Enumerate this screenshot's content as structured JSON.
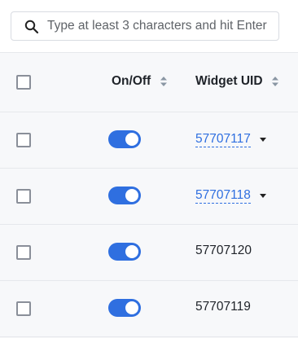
{
  "search": {
    "placeholder": "Type at least 3 characters and hit Enter",
    "value": ""
  },
  "table": {
    "columns": [
      {
        "label": "On/Off",
        "sortable": true
      },
      {
        "label": "Widget UID",
        "sortable": true
      }
    ],
    "rows": [
      {
        "uid": "57707117",
        "enabled": true,
        "has_menu": true,
        "is_link": true
      },
      {
        "uid": "57707118",
        "enabled": true,
        "has_menu": true,
        "is_link": true
      },
      {
        "uid": "57707120",
        "enabled": true,
        "has_menu": false,
        "is_link": false
      },
      {
        "uid": "57707119",
        "enabled": true,
        "has_menu": false,
        "is_link": false
      }
    ]
  },
  "colors": {
    "accent": "#2f6fe0",
    "row_background": "#f7f8fa",
    "border": "#e6e8ec"
  },
  "icons": {
    "search": "search-icon",
    "sort": "sort-icon",
    "row_menu": "caret-down-icon"
  }
}
